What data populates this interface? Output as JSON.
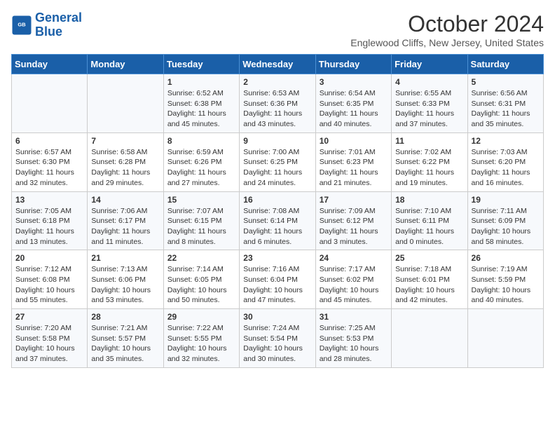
{
  "header": {
    "logo_line1": "General",
    "logo_line2": "Blue",
    "title": "October 2024",
    "location": "Englewood Cliffs, New Jersey, United States"
  },
  "days_of_week": [
    "Sunday",
    "Monday",
    "Tuesday",
    "Wednesday",
    "Thursday",
    "Friday",
    "Saturday"
  ],
  "weeks": [
    [
      {
        "day": "",
        "text": ""
      },
      {
        "day": "",
        "text": ""
      },
      {
        "day": "1",
        "text": "Sunrise: 6:52 AM\nSunset: 6:38 PM\nDaylight: 11 hours and 45 minutes."
      },
      {
        "day": "2",
        "text": "Sunrise: 6:53 AM\nSunset: 6:36 PM\nDaylight: 11 hours and 43 minutes."
      },
      {
        "day": "3",
        "text": "Sunrise: 6:54 AM\nSunset: 6:35 PM\nDaylight: 11 hours and 40 minutes."
      },
      {
        "day": "4",
        "text": "Sunrise: 6:55 AM\nSunset: 6:33 PM\nDaylight: 11 hours and 37 minutes."
      },
      {
        "day": "5",
        "text": "Sunrise: 6:56 AM\nSunset: 6:31 PM\nDaylight: 11 hours and 35 minutes."
      }
    ],
    [
      {
        "day": "6",
        "text": "Sunrise: 6:57 AM\nSunset: 6:30 PM\nDaylight: 11 hours and 32 minutes."
      },
      {
        "day": "7",
        "text": "Sunrise: 6:58 AM\nSunset: 6:28 PM\nDaylight: 11 hours and 29 minutes."
      },
      {
        "day": "8",
        "text": "Sunrise: 6:59 AM\nSunset: 6:26 PM\nDaylight: 11 hours and 27 minutes."
      },
      {
        "day": "9",
        "text": "Sunrise: 7:00 AM\nSunset: 6:25 PM\nDaylight: 11 hours and 24 minutes."
      },
      {
        "day": "10",
        "text": "Sunrise: 7:01 AM\nSunset: 6:23 PM\nDaylight: 11 hours and 21 minutes."
      },
      {
        "day": "11",
        "text": "Sunrise: 7:02 AM\nSunset: 6:22 PM\nDaylight: 11 hours and 19 minutes."
      },
      {
        "day": "12",
        "text": "Sunrise: 7:03 AM\nSunset: 6:20 PM\nDaylight: 11 hours and 16 minutes."
      }
    ],
    [
      {
        "day": "13",
        "text": "Sunrise: 7:05 AM\nSunset: 6:18 PM\nDaylight: 11 hours and 13 minutes."
      },
      {
        "day": "14",
        "text": "Sunrise: 7:06 AM\nSunset: 6:17 PM\nDaylight: 11 hours and 11 minutes."
      },
      {
        "day": "15",
        "text": "Sunrise: 7:07 AM\nSunset: 6:15 PM\nDaylight: 11 hours and 8 minutes."
      },
      {
        "day": "16",
        "text": "Sunrise: 7:08 AM\nSunset: 6:14 PM\nDaylight: 11 hours and 6 minutes."
      },
      {
        "day": "17",
        "text": "Sunrise: 7:09 AM\nSunset: 6:12 PM\nDaylight: 11 hours and 3 minutes."
      },
      {
        "day": "18",
        "text": "Sunrise: 7:10 AM\nSunset: 6:11 PM\nDaylight: 11 hours and 0 minutes."
      },
      {
        "day": "19",
        "text": "Sunrise: 7:11 AM\nSunset: 6:09 PM\nDaylight: 10 hours and 58 minutes."
      }
    ],
    [
      {
        "day": "20",
        "text": "Sunrise: 7:12 AM\nSunset: 6:08 PM\nDaylight: 10 hours and 55 minutes."
      },
      {
        "day": "21",
        "text": "Sunrise: 7:13 AM\nSunset: 6:06 PM\nDaylight: 10 hours and 53 minutes."
      },
      {
        "day": "22",
        "text": "Sunrise: 7:14 AM\nSunset: 6:05 PM\nDaylight: 10 hours and 50 minutes."
      },
      {
        "day": "23",
        "text": "Sunrise: 7:16 AM\nSunset: 6:04 PM\nDaylight: 10 hours and 47 minutes."
      },
      {
        "day": "24",
        "text": "Sunrise: 7:17 AM\nSunset: 6:02 PM\nDaylight: 10 hours and 45 minutes."
      },
      {
        "day": "25",
        "text": "Sunrise: 7:18 AM\nSunset: 6:01 PM\nDaylight: 10 hours and 42 minutes."
      },
      {
        "day": "26",
        "text": "Sunrise: 7:19 AM\nSunset: 5:59 PM\nDaylight: 10 hours and 40 minutes."
      }
    ],
    [
      {
        "day": "27",
        "text": "Sunrise: 7:20 AM\nSunset: 5:58 PM\nDaylight: 10 hours and 37 minutes."
      },
      {
        "day": "28",
        "text": "Sunrise: 7:21 AM\nSunset: 5:57 PM\nDaylight: 10 hours and 35 minutes."
      },
      {
        "day": "29",
        "text": "Sunrise: 7:22 AM\nSunset: 5:55 PM\nDaylight: 10 hours and 32 minutes."
      },
      {
        "day": "30",
        "text": "Sunrise: 7:24 AM\nSunset: 5:54 PM\nDaylight: 10 hours and 30 minutes."
      },
      {
        "day": "31",
        "text": "Sunrise: 7:25 AM\nSunset: 5:53 PM\nDaylight: 10 hours and 28 minutes."
      },
      {
        "day": "",
        "text": ""
      },
      {
        "day": "",
        "text": ""
      }
    ]
  ]
}
